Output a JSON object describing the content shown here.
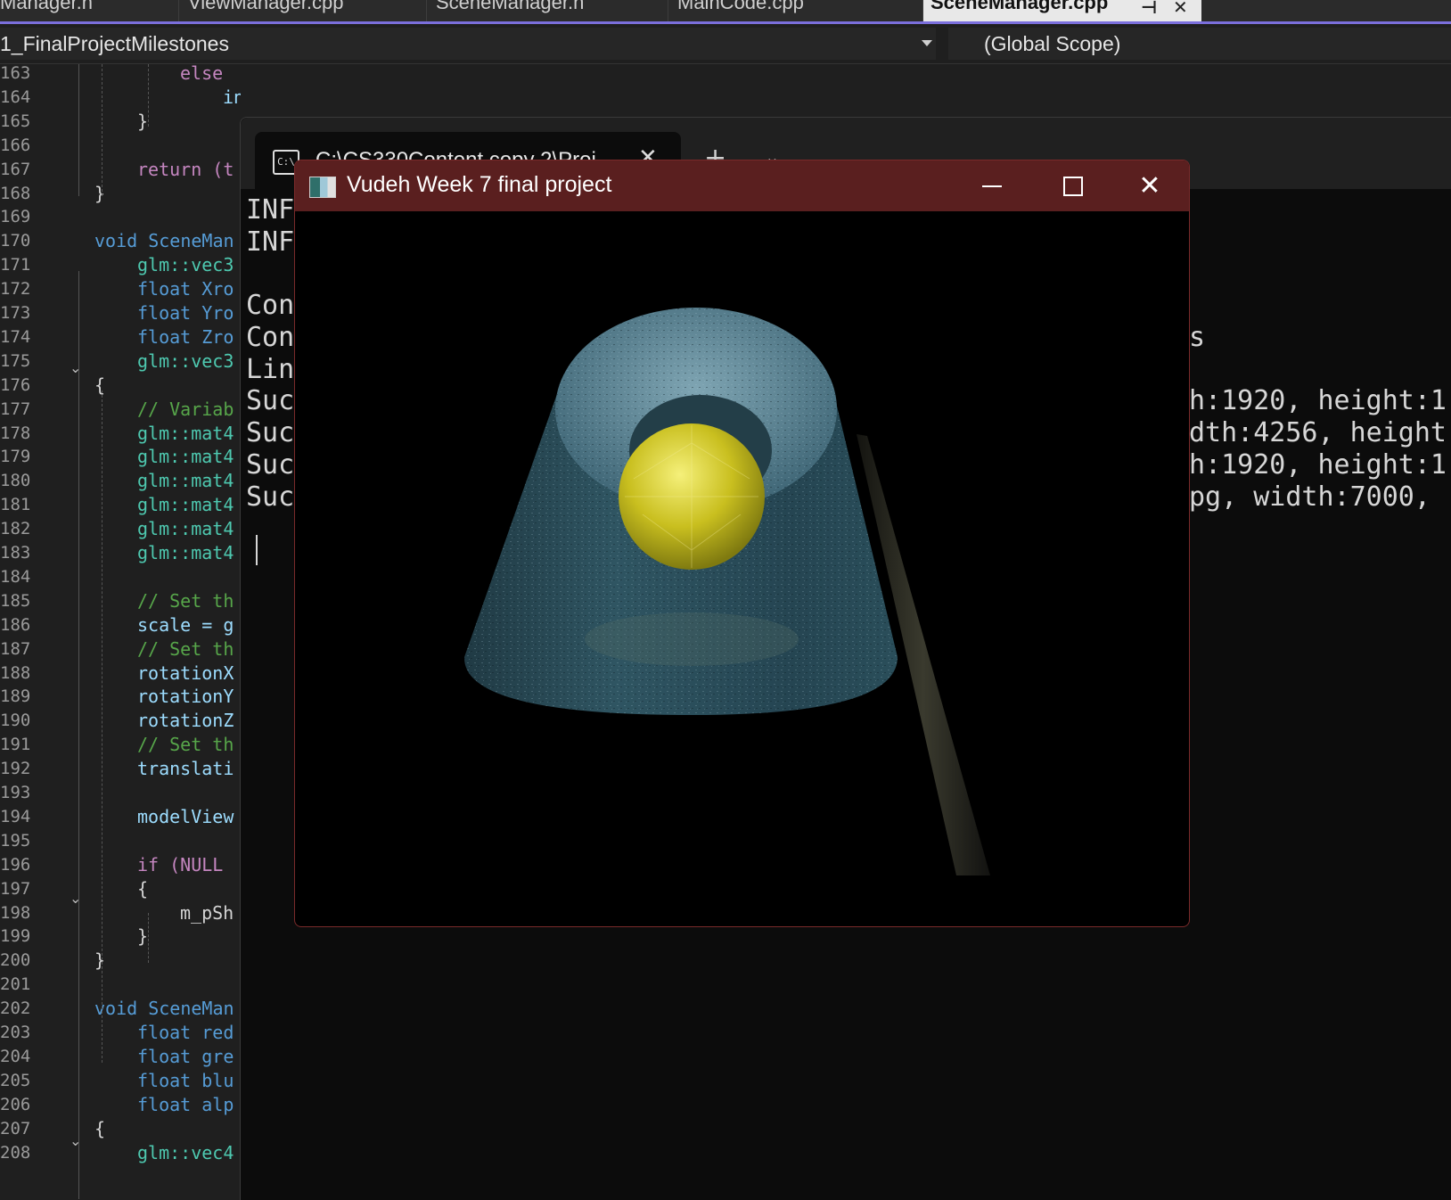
{
  "ide": {
    "tabs": [
      {
        "label": "Manager.h"
      },
      {
        "label": "ViewManager.cpp"
      },
      {
        "label": "SceneManager.h"
      },
      {
        "label": "MainCode.cpp"
      },
      {
        "label": "SceneManager.cpp",
        "active": true
      }
    ],
    "project_dropdown": "1_FinalProjectMilestones",
    "scope_dropdown": "(Global Scope)"
  },
  "editor": {
    "line_numbers": [
      "163",
      "164",
      "165",
      "166",
      "167",
      "168",
      "169",
      "170",
      "171",
      "172",
      "173",
      "174",
      "175",
      "176",
      "177",
      "178",
      "179",
      "180",
      "181",
      "182",
      "183",
      "184",
      "185",
      "186",
      "187",
      "188",
      "189",
      "190",
      "191",
      "192",
      "193",
      "194",
      "195",
      "196",
      "197",
      "198",
      "199",
      "200",
      "201",
      "202",
      "203",
      "204",
      "205",
      "206",
      "207",
      "208"
    ],
    "lines": [
      "else",
      "index++;",
      "}",
      "",
      "return (t",
      "}",
      "",
      "void SceneMan",
      "glm::vec3",
      "float Xro",
      "float Yro",
      "float Zro",
      "glm::vec3",
      "{",
      "// Variab",
      "glm::mat4",
      "glm::mat4",
      "glm::mat4",
      "glm::mat4",
      "glm::mat4",
      "glm::mat4",
      "",
      "// Set th",
      "scale = g",
      "// Set th",
      "rotationX",
      "rotationY",
      "rotationZ",
      "// Set th",
      "translati",
      "",
      "modelView",
      "",
      "if (NULL ",
      "{",
      "m_pSh",
      "}",
      "}",
      "",
      "void SceneMan",
      "float red",
      "float gre",
      "float blu",
      "float alp",
      "{",
      "glm::vec4"
    ]
  },
  "console": {
    "tab_title": "C:\\CS330Content copy 2\\Proj",
    "lines_left": [
      "INF",
      "INF",
      "",
      "Con",
      "Con",
      "Lin",
      "Suc",
      "Suc",
      "Suc",
      "Suc"
    ],
    "lines_right": [
      "s",
      "",
      "h:1920, height:1",
      "dth:4256, height",
      "h:1920, height:1",
      "pg, width:7000,"
    ]
  },
  "gl_window": {
    "title": "Vudeh Week 7 final project",
    "minimize_icon": "minimize-icon",
    "maximize_icon": "maximize-icon",
    "close_icon": "close-icon",
    "titlebar_color": "#5a1f1f"
  },
  "colors": {
    "accent": "#7b6fdc",
    "editor_bg": "#1f1f1f",
    "console_bg": "#0c0c0c"
  }
}
